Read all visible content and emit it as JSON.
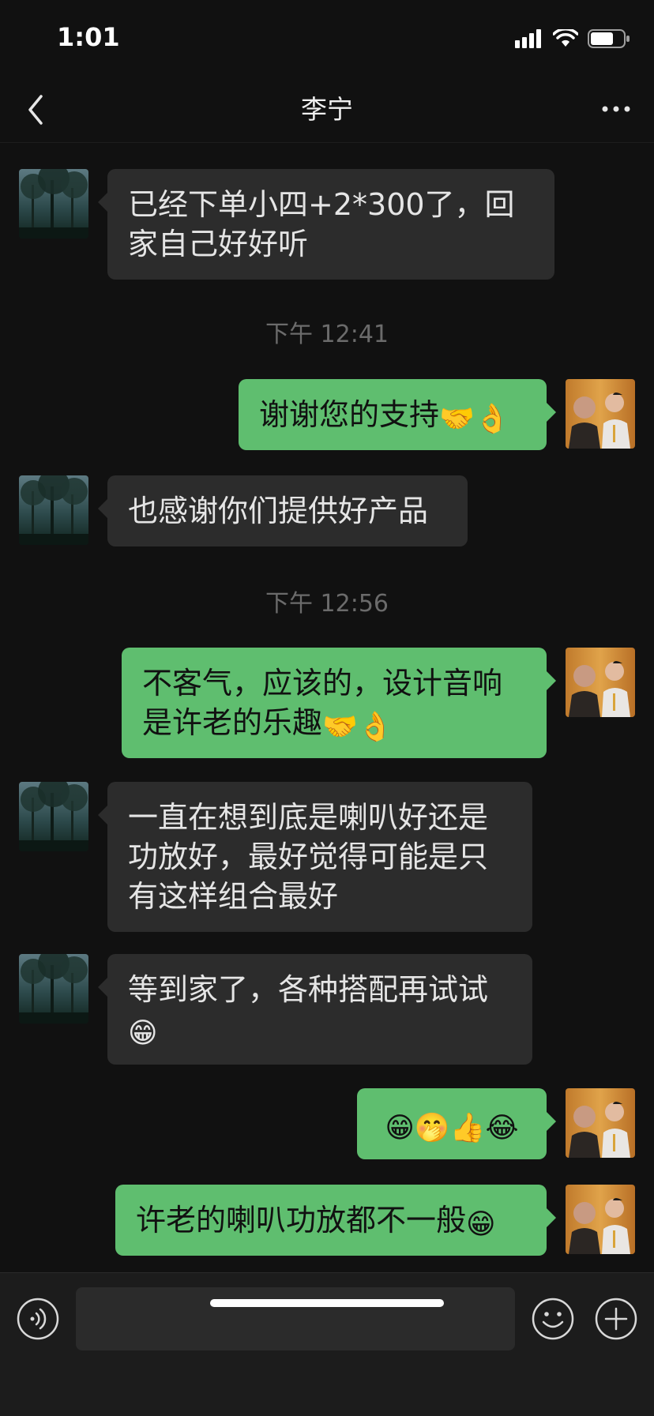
{
  "status": {
    "time": "1:01"
  },
  "header": {
    "title": "李宁"
  },
  "timestamps": [
    "下午 12:41",
    "下午 12:56"
  ],
  "messages": [
    {
      "side": "in",
      "text": "已经下单小四+2*300了，回家自己好好听"
    },
    {
      "side": "out",
      "text": "谢谢您的支持",
      "emoji": "🤝👌"
    },
    {
      "side": "in",
      "text": "也感谢你们提供好产品"
    },
    {
      "side": "out",
      "text": "不客气，应该的，设计音响是许老的乐趣",
      "emoji": "🤝👌"
    },
    {
      "side": "in",
      "text": "一直在想到底是喇叭好还是功放好，最好觉得可能是只有这样组合最好"
    },
    {
      "side": "in",
      "text": "等到家了，各种搭配再试试",
      "emoji": "😁"
    },
    {
      "side": "out",
      "text": "",
      "emoji": "😁🤭👍😂"
    },
    {
      "side": "out",
      "text": "许老的喇叭功放都不一般",
      "emoji": "😁"
    }
  ],
  "icons": {
    "back": "chevron-left-icon",
    "more": "more-dots-icon",
    "voice": "voice-icon",
    "emoji": "emoji-face-icon",
    "plus": "plus-icon"
  },
  "colors": {
    "background": "#111111",
    "incoming_bubble": "#2c2c2c",
    "outgoing_bubble": "#5fbe6f",
    "timestamp": "#6b6b6b"
  }
}
